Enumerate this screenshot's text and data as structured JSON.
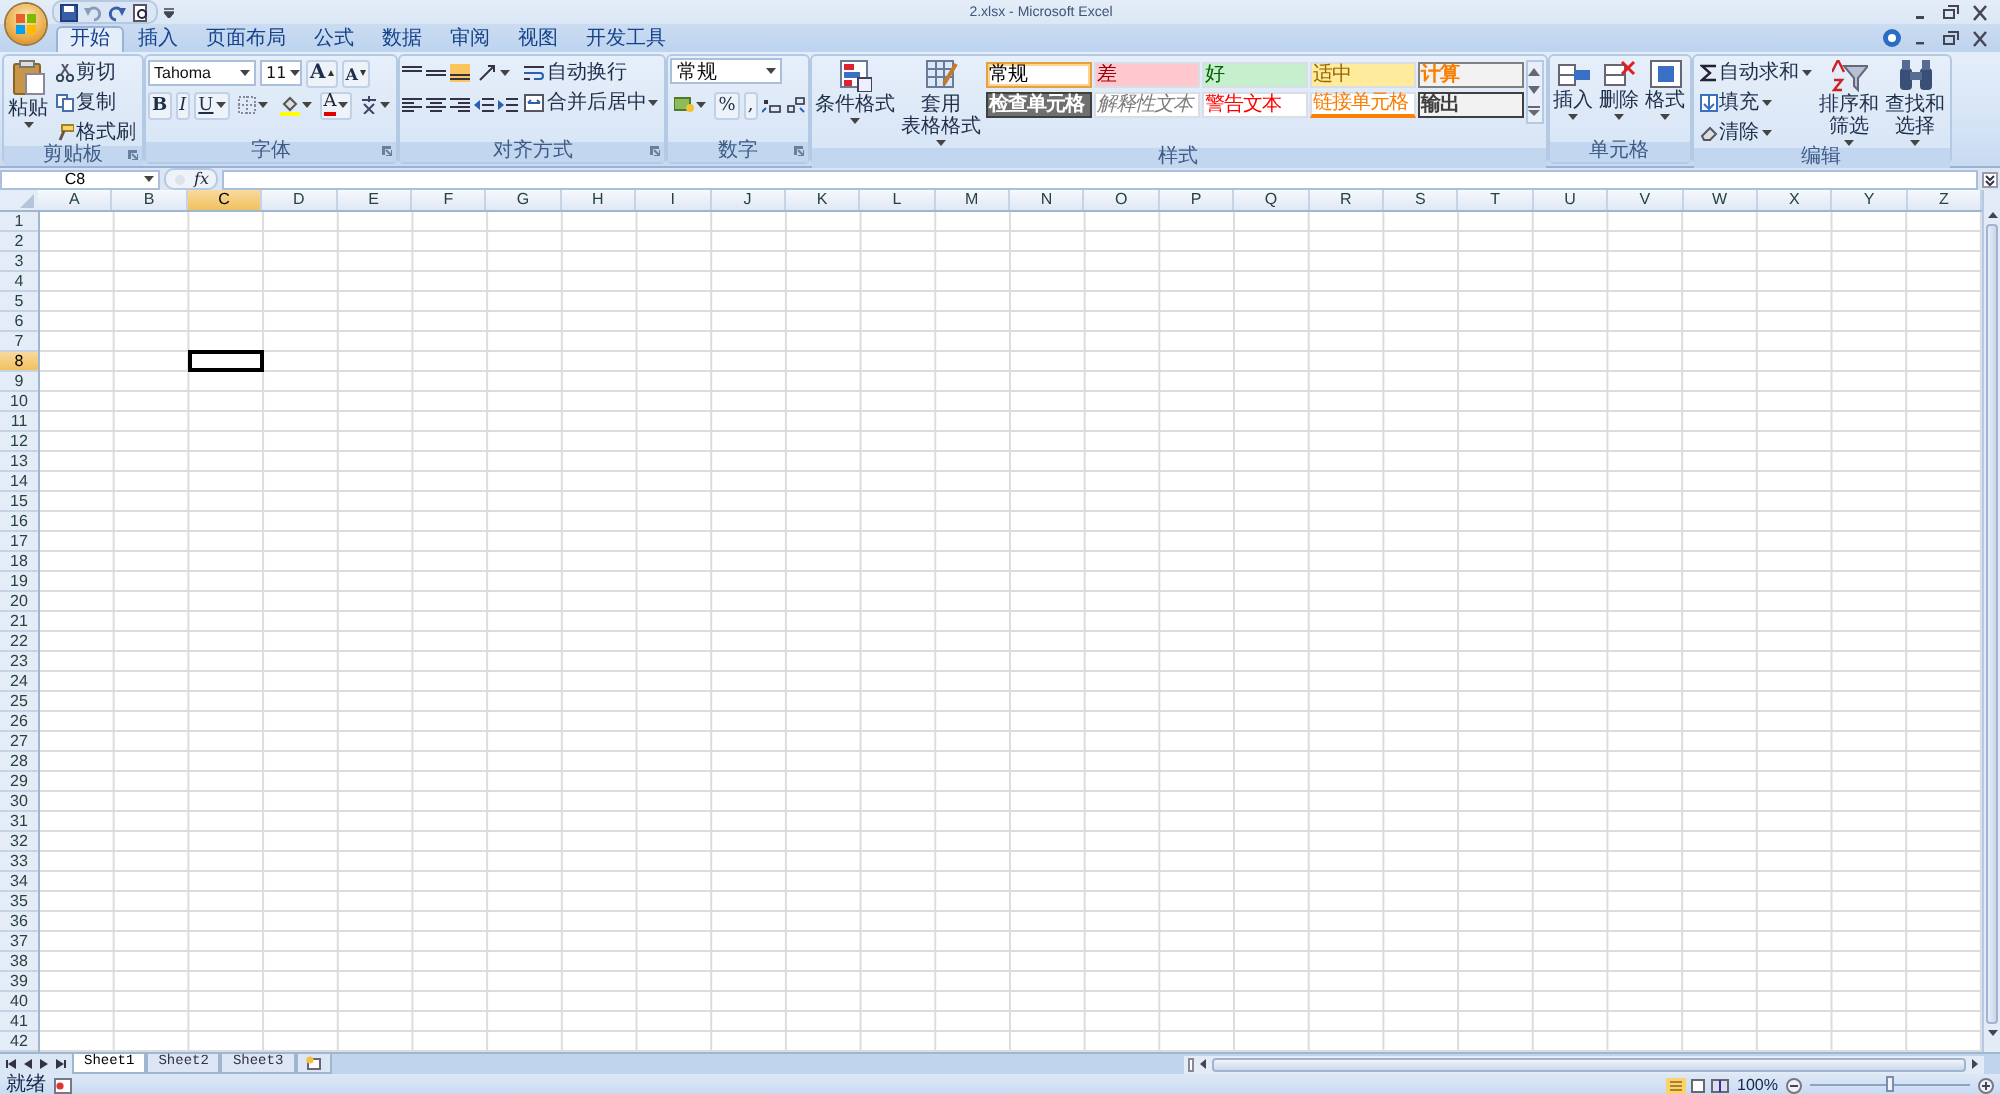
{
  "window": {
    "title": "2.xlsx - Microsoft Excel"
  },
  "tabs": [
    {
      "label": "开始",
      "selected": true
    },
    {
      "label": "插入",
      "selected": false
    },
    {
      "label": "页面布局",
      "selected": false
    },
    {
      "label": "公式",
      "selected": false
    },
    {
      "label": "数据",
      "selected": false
    },
    {
      "label": "审阅",
      "selected": false
    },
    {
      "label": "视图",
      "selected": false
    },
    {
      "label": "开发工具",
      "selected": false
    }
  ],
  "ribbon": {
    "groups": [
      {
        "kind": "clipboard",
        "label": "剪贴板",
        "paste": "粘贴",
        "items": [
          "剪切",
          "复制",
          "格式刷"
        ]
      },
      {
        "kind": "font",
        "label": "字体",
        "font_name": "Tahoma",
        "font_size": "11",
        "grow": "A",
        "shrink": "A",
        "bold": "B",
        "italic": "I",
        "underline": "U",
        "font_color": "A"
      },
      {
        "kind": "alignment",
        "label": "对齐方式",
        "wrap": "自动换行",
        "merge": "合并后居中"
      },
      {
        "kind": "number",
        "label": "数字",
        "format": "常规",
        "percent": "%",
        "comma": ","
      },
      {
        "kind": "styles",
        "label": "样式",
        "conditional_format": [
          "条件格式"
        ],
        "table_format": [
          "套用",
          "表格格式"
        ],
        "cell_styles": [
          {
            "label": "常规",
            "kind": "normal",
            "selected": true
          },
          {
            "label": "差",
            "kind": "bad",
            "selected": false
          },
          {
            "label": "好",
            "kind": "good",
            "selected": false
          },
          {
            "label": "适中",
            "kind": "neutral",
            "selected": false
          },
          {
            "label": "计算",
            "kind": "calculation",
            "selected": false
          },
          {
            "label": "检查单元格",
            "kind": "check",
            "selected": false
          },
          {
            "label": "解释性文本",
            "kind": "explanatory",
            "selected": false
          },
          {
            "label": "警告文本",
            "kind": "warning",
            "selected": false
          },
          {
            "label": "链接单元格",
            "kind": "linked",
            "selected": false
          },
          {
            "label": "输出",
            "kind": "output",
            "selected": false
          }
        ]
      },
      {
        "kind": "cells",
        "label": "单元格",
        "buttons": [
          "插入",
          "删除",
          "格式"
        ]
      },
      {
        "kind": "editing",
        "label": "编辑",
        "items": [
          "自动求和",
          "填充",
          "清除"
        ],
        "sort": [
          "排序和",
          "筛选"
        ],
        "find": [
          "查找和",
          "选择"
        ]
      }
    ]
  },
  "formula_bar": {
    "name_box": "C8",
    "function_label": "fx"
  },
  "grid": {
    "columns": [
      {
        "label": "A",
        "selected": false
      },
      {
        "label": "B",
        "selected": false
      },
      {
        "label": "C",
        "selected": true
      },
      {
        "label": "D",
        "selected": false
      },
      {
        "label": "E",
        "selected": false
      },
      {
        "label": "F",
        "selected": false
      },
      {
        "label": "G",
        "selected": false
      },
      {
        "label": "H",
        "selected": false
      },
      {
        "label": "I",
        "selected": false
      },
      {
        "label": "J",
        "selected": false
      },
      {
        "label": "K",
        "selected": false
      },
      {
        "label": "L",
        "selected": false
      },
      {
        "label": "M",
        "selected": false
      },
      {
        "label": "N",
        "selected": false
      },
      {
        "label": "O",
        "selected": false
      },
      {
        "label": "P",
        "selected": false
      },
      {
        "label": "Q",
        "selected": false
      },
      {
        "label": "R",
        "selected": false
      },
      {
        "label": "S",
        "selected": false
      },
      {
        "label": "T",
        "selected": false
      },
      {
        "label": "U",
        "selected": false
      },
      {
        "label": "V",
        "selected": false
      },
      {
        "label": "W",
        "selected": false
      },
      {
        "label": "X",
        "selected": false
      },
      {
        "label": "Y",
        "selected": false
      },
      {
        "label": "Z",
        "selected": false
      }
    ],
    "rows": [
      {
        "label": "1",
        "selected": false
      },
      {
        "label": "2",
        "selected": false
      },
      {
        "label": "3",
        "selected": false
      },
      {
        "label": "4",
        "selected": false
      },
      {
        "label": "5",
        "selected": false
      },
      {
        "label": "6",
        "selected": false
      },
      {
        "label": "7",
        "selected": false
      },
      {
        "label": "8",
        "selected": true
      },
      {
        "label": "9",
        "selected": false
      },
      {
        "label": "10",
        "selected": false
      },
      {
        "label": "11",
        "selected": false
      },
      {
        "label": "12",
        "selected": false
      },
      {
        "label": "13",
        "selected": false
      },
      {
        "label": "14",
        "selected": false
      },
      {
        "label": "15",
        "selected": false
      },
      {
        "label": "16",
        "selected": false
      },
      {
        "label": "17",
        "selected": false
      },
      {
        "label": "18",
        "selected": false
      },
      {
        "label": "19",
        "selected": false
      },
      {
        "label": "20",
        "selected": false
      },
      {
        "label": "21",
        "selected": false
      },
      {
        "label": "22",
        "selected": false
      },
      {
        "label": "23",
        "selected": false
      },
      {
        "label": "24",
        "selected": false
      },
      {
        "label": "25",
        "selected": false
      },
      {
        "label": "26",
        "selected": false
      },
      {
        "label": "27",
        "selected": false
      },
      {
        "label": "28",
        "selected": false
      },
      {
        "label": "29",
        "selected": false
      },
      {
        "label": "30",
        "selected": false
      },
      {
        "label": "31",
        "selected": false
      },
      {
        "label": "32",
        "selected": false
      },
      {
        "label": "33",
        "selected": false
      },
      {
        "label": "34",
        "selected": false
      },
      {
        "label": "35",
        "selected": false
      },
      {
        "label": "36",
        "selected": false
      },
      {
        "label": "37",
        "selected": false
      },
      {
        "label": "38",
        "selected": false
      },
      {
        "label": "39",
        "selected": false
      },
      {
        "label": "40",
        "selected": false
      },
      {
        "label": "41",
        "selected": false
      },
      {
        "label": "42",
        "selected": false
      }
    ]
  },
  "sheet_tabs": [
    {
      "label": "Sheet1",
      "selected": true
    },
    {
      "label": "Sheet2",
      "selected": false
    },
    {
      "label": "Sheet3",
      "selected": false
    }
  ],
  "status_bar": {
    "mode": "就绪",
    "zoom": "100%",
    "zoom_slider": {
      "level": 0.5
    }
  }
}
